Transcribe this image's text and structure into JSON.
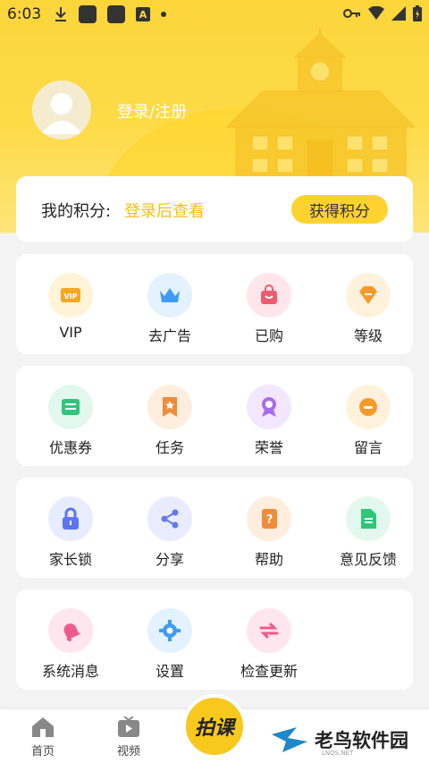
{
  "status_bar": {
    "time": "6:03",
    "a_badge": "A"
  },
  "profile": {
    "login_text": "登录/注册"
  },
  "points": {
    "label": "我的积分:",
    "value": "登录后查看",
    "button": "获得积分"
  },
  "groups": [
    [
      {
        "label": "VIP",
        "icon": "vip-icon",
        "bg": "#fff3d8",
        "color": "#f5a623"
      },
      {
        "label": "去广告",
        "icon": "crown-icon",
        "bg": "#e4f1ff",
        "color": "#3f9cf5"
      },
      {
        "label": "已购",
        "icon": "shopping-bag-icon",
        "bg": "#ffe6ea",
        "color": "#f05a6e"
      },
      {
        "label": "等级",
        "icon": "diamond-icon",
        "bg": "#fff1dc",
        "color": "#f59a2b"
      }
    ],
    [
      {
        "label": "优惠券",
        "icon": "coupon-icon",
        "bg": "#e2f8ee",
        "color": "#2fc67a"
      },
      {
        "label": "任务",
        "icon": "bookmark-star-icon",
        "bg": "#ffeedd",
        "color": "#f08b3a"
      },
      {
        "label": "荣誉",
        "icon": "medal-icon",
        "bg": "#f3e6ff",
        "color": "#a86bf0"
      },
      {
        "label": "留言",
        "icon": "message-icon",
        "bg": "#fff1dc",
        "color": "#f59a2b"
      }
    ],
    [
      {
        "label": "家长锁",
        "icon": "lock-icon",
        "bg": "#e7ecff",
        "color": "#5a74f2"
      },
      {
        "label": "分享",
        "icon": "share-icon",
        "bg": "#e9ecff",
        "color": "#6378f2"
      },
      {
        "label": "帮助",
        "icon": "help-book-icon",
        "bg": "#ffeedd",
        "color": "#f08b3a"
      },
      {
        "label": "意见反馈",
        "icon": "document-icon",
        "bg": "#e2f8ee",
        "color": "#2fc67a"
      }
    ],
    [
      {
        "label": "系统消息",
        "icon": "bell-icon",
        "bg": "#ffe6ee",
        "color": "#f05a8a"
      },
      {
        "label": "设置",
        "icon": "gear-icon",
        "bg": "#e4f1ff",
        "color": "#3f9cf5"
      },
      {
        "label": "检查更新",
        "icon": "refresh-icon",
        "bg": "#ffe6ee",
        "color": "#f05a8a"
      }
    ]
  ],
  "tabbar": {
    "home": "首页",
    "video": "视频",
    "center": "拍课"
  },
  "watermark": {
    "title": "老鸟软件园",
    "sub": "LNQS.NET"
  }
}
